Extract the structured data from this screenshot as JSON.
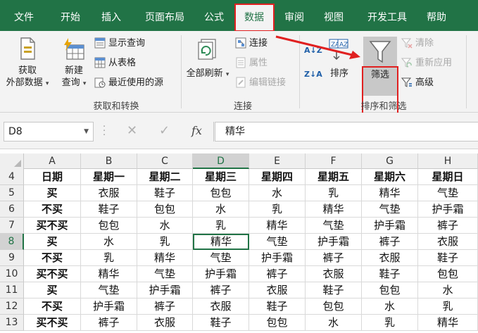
{
  "tabs": [
    "文件",
    "开始",
    "插入",
    "页面布局",
    "公式",
    "数据",
    "审阅",
    "视图",
    "开发工具",
    "帮助"
  ],
  "active_tab": "数据",
  "ribbon": {
    "get_data": {
      "line1": "获取",
      "line2": "外部数据"
    },
    "new_query": {
      "line1": "新建",
      "line2": "查询"
    },
    "show_queries": "显示查询",
    "from_table": "从表格",
    "recent_sources": "最近使用的源",
    "group_get_transform": "获取和转换",
    "refresh_all": "全部刷新",
    "connections": "连接",
    "properties": "属性",
    "edit_links": "编辑链接",
    "group_connections": "连接",
    "sort_az": "A↓Z",
    "sort_za": "Z↓A",
    "sort": "排序",
    "filter": "筛选",
    "clear": "清除",
    "reapply": "重新应用",
    "advanced": "高级",
    "group_sort_filter": "排序和筛选"
  },
  "formula_bar": {
    "name_box": "D8",
    "cancel_icon": "✕",
    "enter_icon": "✓",
    "fx_label": "fx",
    "content": "精华"
  },
  "sheet": {
    "columns": [
      "A",
      "B",
      "C",
      "D",
      "E",
      "F",
      "G",
      "H"
    ],
    "selected_column": "D",
    "selected_row": "8",
    "active_cell": "D8",
    "rows": [
      {
        "num": "4",
        "cells": [
          "日期",
          "星期一",
          "星期二",
          "星期三",
          "星期四",
          "星期五",
          "星期六",
          "星期日"
        ]
      },
      {
        "num": "5",
        "cells": [
          "买",
          "衣服",
          "鞋子",
          "包包",
          "水",
          "乳",
          "精华",
          "气垫"
        ]
      },
      {
        "num": "6",
        "cells": [
          "不买",
          "鞋子",
          "包包",
          "水",
          "乳",
          "精华",
          "气垫",
          "护手霜"
        ]
      },
      {
        "num": "7",
        "cells": [
          "买不买",
          "包包",
          "水",
          "乳",
          "精华",
          "气垫",
          "护手霜",
          "裤子"
        ]
      },
      {
        "num": "8",
        "cells": [
          "买",
          "水",
          "乳",
          "精华",
          "气垫",
          "护手霜",
          "裤子",
          "衣服"
        ]
      },
      {
        "num": "9",
        "cells": [
          "不买",
          "乳",
          "精华",
          "气垫",
          "护手霜",
          "裤子",
          "衣服",
          "鞋子"
        ]
      },
      {
        "num": "10",
        "cells": [
          "买不买",
          "精华",
          "气垫",
          "护手霜",
          "裤子",
          "衣服",
          "鞋子",
          "包包"
        ]
      },
      {
        "num": "11",
        "cells": [
          "买",
          "气垫",
          "护手霜",
          "裤子",
          "衣服",
          "鞋子",
          "包包",
          "水"
        ]
      },
      {
        "num": "12",
        "cells": [
          "不买",
          "护手霜",
          "裤子",
          "衣服",
          "鞋子",
          "包包",
          "水",
          "乳"
        ]
      },
      {
        "num": "13",
        "cells": [
          "买不买",
          "裤子",
          "衣服",
          "鞋子",
          "包包",
          "水",
          "乳",
          "精华"
        ]
      }
    ]
  },
  "colors": {
    "ribbon_green": "#217346",
    "highlight_red": "#e02020",
    "filter_bg": "#c8c8c8"
  }
}
